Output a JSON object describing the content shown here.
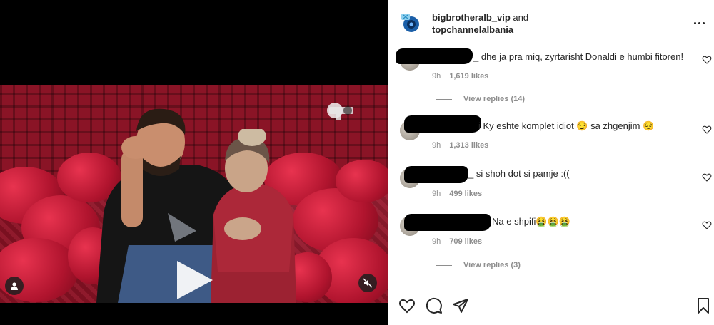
{
  "post": {
    "author_1": "bigbrotheralb_vip",
    "joiner": "and",
    "author_2": "topchannelalbania"
  },
  "comments": [
    {
      "text": "_ dhe ja pra miq, zyrtarisht Donaldi e humbi fitoren!",
      "time": "9h",
      "likes": "1,619 likes",
      "replies": "View replies (14)"
    },
    {
      "text": "i Ky eshte komplet idiot 😏 sa zhgenjim 😔",
      "time": "9h",
      "likes": "1,313 likes"
    },
    {
      "text": "_ si shoh dot si pamje :((",
      "time": "9h",
      "likes": "499 likes"
    },
    {
      "text": "Na e shpifi🤮🤮🤮",
      "time": "9h",
      "likes": "709 likes",
      "replies": "View replies (3)"
    }
  ],
  "icons": {
    "like": "heart-icon",
    "comment": "comment-icon",
    "share": "paper-plane-icon",
    "save": "bookmark-icon",
    "more": "more-options-icon",
    "play": "play-icon",
    "mute": "muted-speaker-icon",
    "tag": "user-tag-icon"
  },
  "colors": {
    "text": "#262626",
    "secondary": "#8e8e8e",
    "border": "#efefef",
    "sofa": "#c41e3a"
  }
}
